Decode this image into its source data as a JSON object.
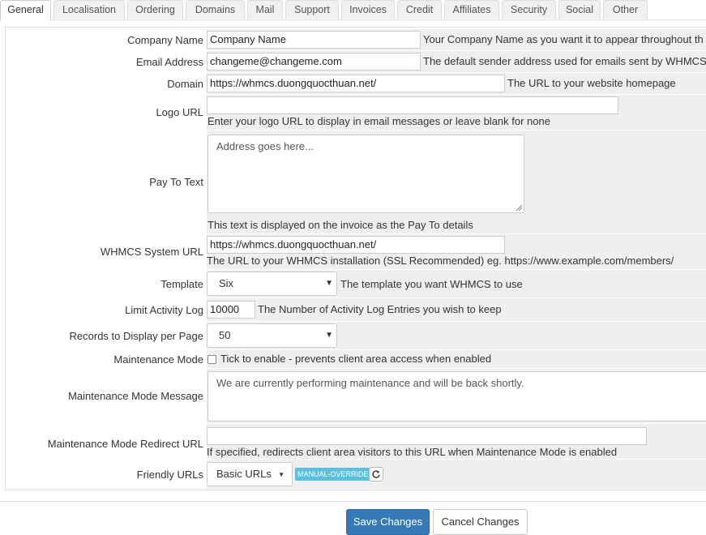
{
  "tabs": [
    "General",
    "Localisation",
    "Ordering",
    "Domains",
    "Mail",
    "Support",
    "Invoices",
    "Credit",
    "Affiliates",
    "Security",
    "Social",
    "Other"
  ],
  "active_tab": "General",
  "form": {
    "company_name": {
      "label": "Company Name",
      "value": "Company Name",
      "help": "Your Company Name as you want it to appear throughout th"
    },
    "email_address": {
      "label": "Email Address",
      "value": "changeme@changeme.com",
      "help": "The default sender address used for emails sent by WHMCS"
    },
    "domain": {
      "label": "Domain",
      "value": "https://whmcs.duongquocthuan.net/",
      "help": "The URL to your website homepage"
    },
    "logo_url": {
      "label": "Logo URL",
      "value": "",
      "help": "Enter your logo URL to display in email messages or leave blank for none"
    },
    "pay_to_text": {
      "label": "Pay To Text",
      "placeholder": "Address goes here...",
      "help": "This text is displayed on the invoice as the Pay To details"
    },
    "system_url": {
      "label": "WHMCS System URL",
      "value": "https://whmcs.duongquocthuan.net/",
      "help": "The URL to your WHMCS installation (SSL Recommended) eg. https://www.example.com/members/"
    },
    "template": {
      "label": "Template",
      "value": "Six",
      "help": "The template you want WHMCS to use"
    },
    "activity_log": {
      "label": "Limit Activity Log",
      "value": "10000",
      "help": "The Number of Activity Log Entries you wish to keep"
    },
    "records_per_page": {
      "label": "Records to Display per Page",
      "value": "50"
    },
    "maintenance_mode": {
      "label": "Maintenance Mode",
      "checked": false,
      "help": "Tick to enable - prevents client area access when enabled"
    },
    "maintenance_message": {
      "label": "Maintenance Mode Message",
      "value": "We are currently performing maintenance and will be back shortly."
    },
    "maintenance_redirect": {
      "label": "Maintenance Mode Redirect URL",
      "value": "",
      "help": "If specified, redirects client area visitors to this URL when Maintenance Mode is enabled"
    },
    "friendly_urls": {
      "label": "Friendly URLs",
      "value": "Basic URLs",
      "badge": "MANUAL-OVERRIDE"
    }
  },
  "buttons": {
    "save": "Save Changes",
    "cancel": "Cancel Changes"
  },
  "icons": {
    "refresh": "refresh-icon",
    "caret": "caret-down-icon"
  },
  "colors": {
    "primary": "#337ab7",
    "badge": "#5bc0de",
    "field_bg": "#efefef"
  }
}
